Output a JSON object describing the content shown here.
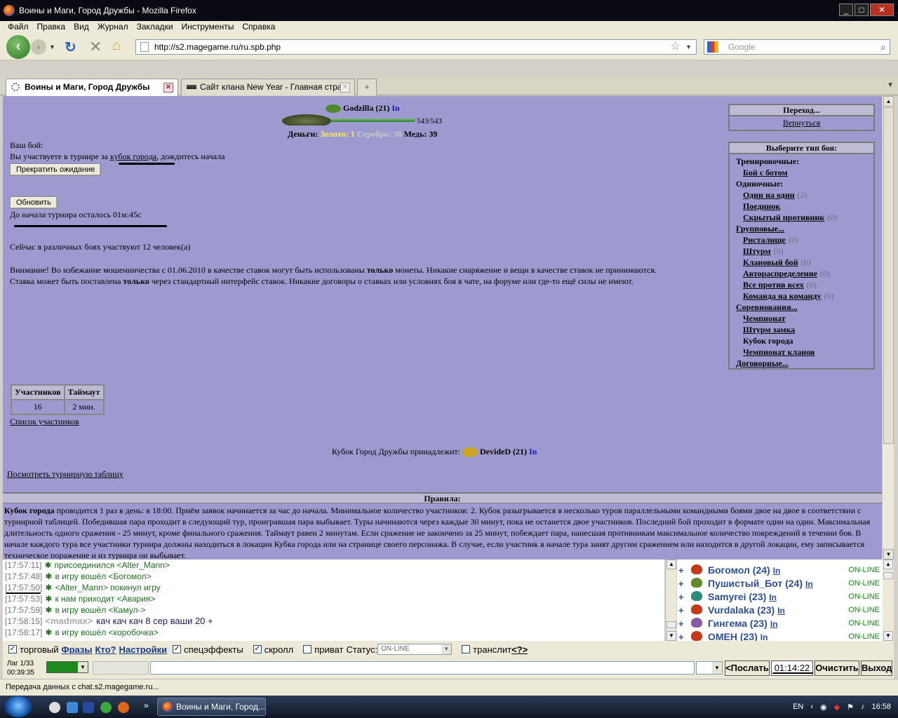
{
  "window": {
    "title": "Воины и Маги, Город Дружбы - Mozilla Firefox"
  },
  "menu": [
    "Файл",
    "Правка",
    "Вид",
    "Журнал",
    "Закладки",
    "Инструменты",
    "Справка"
  ],
  "nav": {
    "url": "http://s2.magegame.ru/ru.spb.php",
    "search_placeholder": "Google"
  },
  "tabs": [
    {
      "label": "Воины и Маги, Город Дружбы",
      "active": true
    },
    {
      "label": "Сайт клана New Year - Главная стра...",
      "active": false
    }
  ],
  "player": {
    "name": "Godzilla (21)",
    "status_link": "In",
    "hp": "543/543",
    "hp_fraction": 1.0,
    "money_label": "Деньги:",
    "gold": "Золото: 1",
    "silver": "Серебро: 38",
    "copper": "Медь: 39"
  },
  "fight": {
    "your_fight": "Ваш бой:",
    "tournament_pre": "Вы участвуете в турнире за ",
    "tournament_link": "кубок города",
    "tournament_post": ", дождитесь начала",
    "stop_button": "Прекратить ожидание",
    "refresh_button": "Обновить",
    "countdown": "До начала турнира осталось 01м:45с",
    "participants_now": "Сейчас в различных боях участвуют 12 человек(а)",
    "warning_1a": "Внимание! Во избежание мошенничества с 01.06.2010 в качестве ставок могут быть использованы ",
    "warning_1b": "только",
    "warning_1c": " монеты. Никакие снаряжение и вещи в качестве ставок не принимаются.",
    "warning_2a": "Ставка может быть поставлена ",
    "warning_2b": "только",
    "warning_2c": " через стандартный интерфейс ставок. Никакие договоры о ставках или условиях боя в чате, на форуме или где-то ещё силы не имеют."
  },
  "stats_table": {
    "headers": [
      "Участников",
      "Таймаут"
    ],
    "values": [
      "16",
      "2 мин."
    ]
  },
  "participants_link": "Список участников",
  "cup_owner": {
    "label": "Кубок Город Дружбы принадлежит:",
    "name": "DevideD (21)",
    "status_link": "In"
  },
  "tournament_table_link": "Посмотреть турнирную таблицу",
  "sidebar": {
    "nav_header": "Переход...",
    "back_link": "Вернуться",
    "types_header": "Выберите тип боя:",
    "items": [
      {
        "label": "Тренировочные:",
        "indent": false,
        "link": false,
        "count": ""
      },
      {
        "label": "Бой с ботом",
        "indent": true,
        "link": true,
        "count": ""
      },
      {
        "label": "Одиночные:",
        "indent": false,
        "link": false,
        "count": ""
      },
      {
        "label": "Один на один",
        "indent": true,
        "link": true,
        "count": "(2)"
      },
      {
        "label": "Поединок",
        "indent": true,
        "link": true,
        "count": ""
      },
      {
        "label": "Скрытый противник",
        "indent": true,
        "link": true,
        "count": "(0)"
      },
      {
        "label": "Групповые...",
        "indent": false,
        "link": true,
        "count": ""
      },
      {
        "label": "Ристалище",
        "indent": true,
        "link": true,
        "count": "(0)"
      },
      {
        "label": "Штурм",
        "indent": true,
        "link": true,
        "count": "(0)"
      },
      {
        "label": "Клановый бой",
        "indent": true,
        "link": true,
        "count": "(0)"
      },
      {
        "label": "Автораспределение",
        "indent": true,
        "link": true,
        "count": "(0)"
      },
      {
        "label": "Все против всех",
        "indent": true,
        "link": true,
        "count": "(0)"
      },
      {
        "label": "Команда на команду",
        "indent": true,
        "link": true,
        "count": "(0)"
      },
      {
        "label": "Соревнования...",
        "indent": false,
        "link": true,
        "count": ""
      },
      {
        "label": "Чемпионат",
        "indent": true,
        "link": true,
        "count": ""
      },
      {
        "label": "Штурм замка",
        "indent": true,
        "link": true,
        "count": ""
      },
      {
        "label": "Кубок города",
        "indent": true,
        "link": false,
        "count": ""
      },
      {
        "label": "Чемпионат кланов",
        "indent": true,
        "link": true,
        "count": ""
      },
      {
        "label": "Договорные...",
        "indent": false,
        "link": true,
        "count": ""
      }
    ]
  },
  "rules": {
    "header": "Правила:",
    "bold_start": "Кубок города",
    "text": " проводится 1 раз в день: в 18:00. Приём заявок начинается за час до начала. Минимальное количество участников: 2. Кубок разыгрывается в несколько туров параллельными командными боями двое на двое в соответствии с турнирной таблицей. Победившая пара проходит в следующий тур, проигравшая пара выбывает. Туры начинаются через каждые 30 минут, пока не останется двое участников. Последний бой проходит в формате один на один. Максимальная длительность одного сражения - 25 минут, кроме финального сражения. Таймаут равен 2 минутам. Если сражение не закончено за 25 минут, побеждает пара, нанесшая противникам максимальное количество повреждений в течении боя. В начале каждого тура все участники турнира должны находиться в локации Кубка города или на странице своего персонажа. В случае, если участник в начале тура занят другим сражением или находится в другой локации, ему записывается техническое поражение и из турнира он выбывает."
  },
  "chat": [
    {
      "time": "[17:57:11]",
      "text": "присоединился <Alter_Mann>",
      "type": "event"
    },
    {
      "time": "[17:57:48]",
      "text": "в игру вошёл <Богомол>",
      "type": "event"
    },
    {
      "time": "[17:57:50]",
      "text": "<Alter_Mann> покинул игру",
      "type": "event"
    },
    {
      "time": "[17:57:53]",
      "text": "к нам приходит <Авария>",
      "type": "event"
    },
    {
      "time": "[17:57:59]",
      "text": "в игру вошёл <Камул->",
      "type": "event"
    },
    {
      "time": "[17:58:15]",
      "nick": "<madmax>",
      "text": "кач кач кач 8 сер ваши 20 +",
      "type": "message"
    },
    {
      "time": "[17:58:17]",
      "text": "в игру вошёл <коробочка>",
      "type": "event"
    }
  ],
  "users": [
    {
      "name": "Богомол (24)",
      "in": "In",
      "status": "ON-LINE",
      "color": "#c23a1a"
    },
    {
      "name": "Пушистый_Бот (24)",
      "in": "In",
      "status": "ON-LINE",
      "color": "#5f8a2a"
    },
    {
      "name": "Samyrei (23)",
      "in": "In",
      "status": "ON-LINE",
      "color": "#2e8a7a"
    },
    {
      "name": "Vurdalaka (23)",
      "in": "In",
      "status": "ON-LINE",
      "color": "#c23a1a"
    },
    {
      "name": "Гингема (23)",
      "in": "In",
      "status": "ON-LINE",
      "color": "#8a5aa0"
    },
    {
      "name": "ОМЕН (23)",
      "in": "In",
      "status": "ON-LINE",
      "color": "#c23a1a"
    }
  ],
  "options": {
    "trade": "торговый",
    "phrases": "Фразы",
    "who": "Кто?",
    "settings": "Настройки",
    "effects": "спецэффекты",
    "scroll": "скролл",
    "private": "приват",
    "status_label": "Статус:",
    "status_value": "ON-LINE",
    "translit": "транслит",
    "translit_help": "<?>"
  },
  "input": {
    "lag": "Лаг 1/33",
    "time": "00:39:35",
    "send": "<Послать",
    "clock": "01:14:22",
    "clear": "Очистить",
    "exit": "Выход"
  },
  "statusbar": "Передача данных с chat.s2.magegame.ru...",
  "taskbar": {
    "task": "Воины и Маги, Город...",
    "lang": "EN",
    "time": "16:58"
  }
}
